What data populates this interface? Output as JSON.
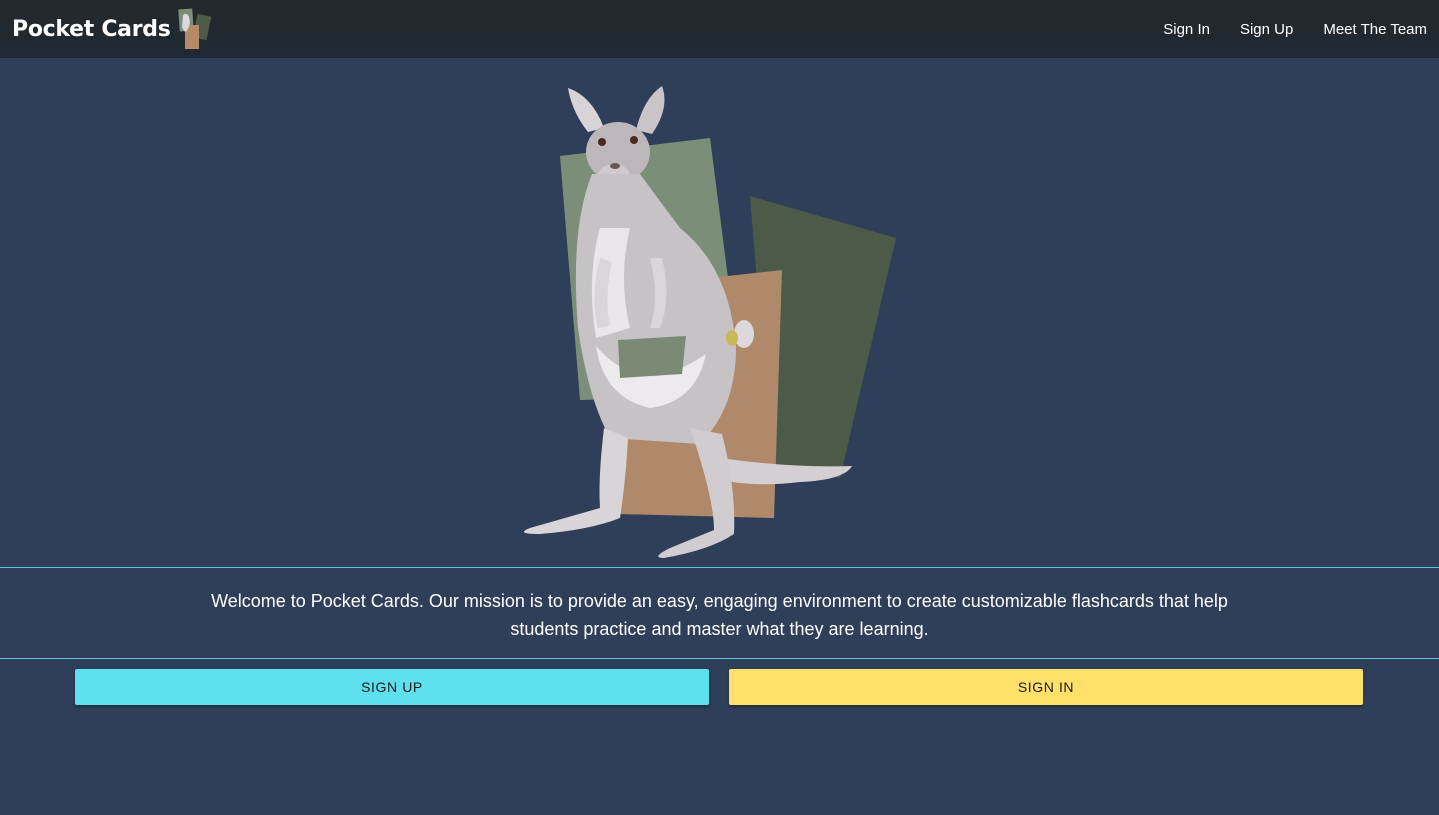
{
  "navbar": {
    "brand": "Pocket Cards",
    "links": [
      "Sign In",
      "Sign Up",
      "Meet The Team"
    ]
  },
  "hero": {
    "illustration": "kangaroo-with-flashcards"
  },
  "mission": {
    "text": "Welcome to Pocket Cards. Our mission is to provide an easy, engaging environment to create customizable flashcards that help students practice and master what they are learning."
  },
  "actions": {
    "signup_label": "SIGN UP",
    "signin_label": "SIGN IN"
  },
  "colors": {
    "background": "#2f3f5a",
    "navbar": "#22292d",
    "divider": "#5ec8d8",
    "signup": "#5fe0ee",
    "signin": "#ffe06a"
  }
}
